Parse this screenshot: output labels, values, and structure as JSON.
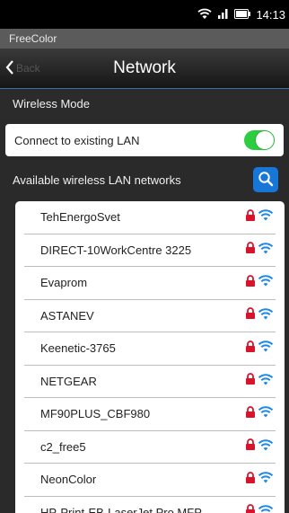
{
  "status_bar": {
    "time": "14:13"
  },
  "app": {
    "title": "FreeColor"
  },
  "nav": {
    "back_label": "Back",
    "title": "Network"
  },
  "wireless_mode": {
    "label": "Wireless Mode"
  },
  "connect": {
    "label": "Connect to existing LAN",
    "enabled": true
  },
  "available": {
    "label": "Available wireless LAN networks"
  },
  "networks": [
    {
      "name": "TehEnergoSvet"
    },
    {
      "name": "DIRECT-10WorkCentre 3225"
    },
    {
      "name": "Evaprom"
    },
    {
      "name": "ASTANEV"
    },
    {
      "name": "Keenetic-3765"
    },
    {
      "name": "NETGEAR"
    },
    {
      "name": "MF90PLUS_CBF980"
    },
    {
      "name": "c2_free5"
    },
    {
      "name": "NeonColor"
    },
    {
      "name": "HP-Print-EB-LaserJet Pro MFP"
    }
  ],
  "colors": {
    "lock": "#d8132a",
    "wifi": "#1e88e5",
    "toggle_on": "#2ecc40",
    "search_button": "#1876d6"
  }
}
